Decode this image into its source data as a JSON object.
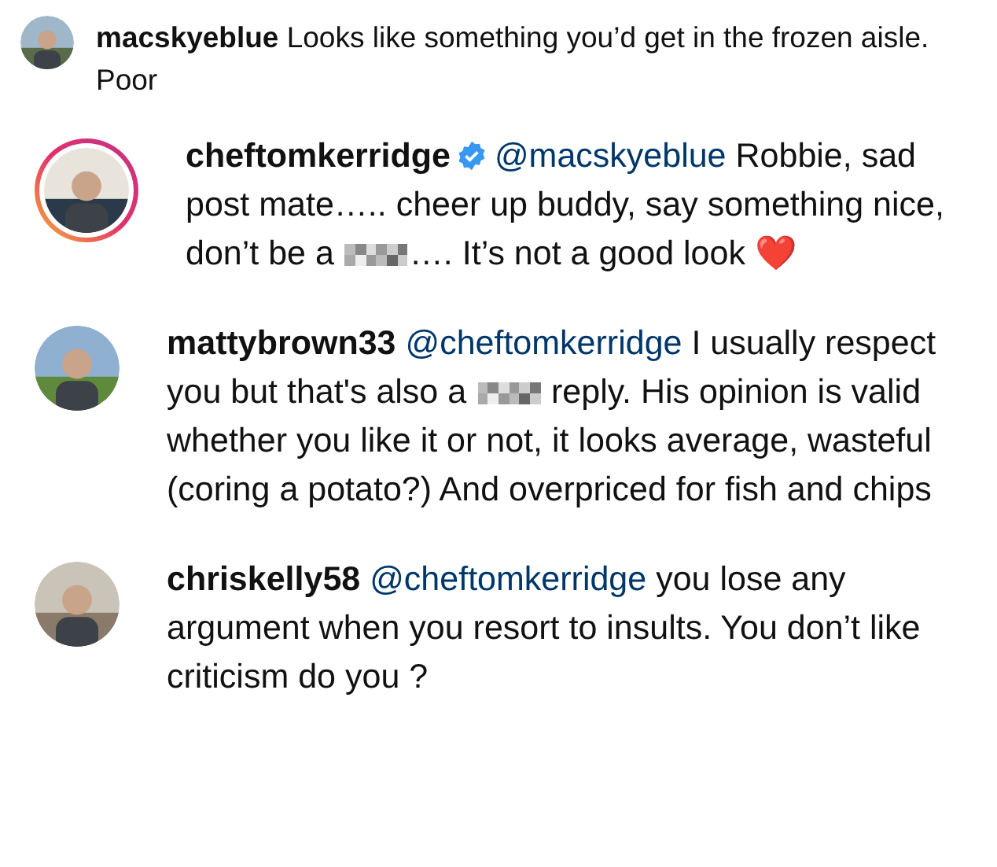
{
  "comments": [
    {
      "kind": "top",
      "username": "macskyeblue",
      "ring": false,
      "verified": false,
      "segments": [
        {
          "kind": "text",
          "text": "Looks like something you’d get in the frozen aisle. Poor"
        }
      ]
    },
    {
      "kind": "reply",
      "username": "cheftomkerridge",
      "ring": true,
      "verified": true,
      "segments": [
        {
          "kind": "mention",
          "text": "@macskyeblue"
        },
        {
          "kind": "text",
          "text": " Robbie, sad post mate….. cheer up buddy, say something nice, don’t be a "
        },
        {
          "kind": "censored"
        },
        {
          "kind": "text",
          "text": "…. It’s not a good look ❤️"
        }
      ]
    },
    {
      "kind": "reply",
      "username": "mattybrown33",
      "ring": false,
      "verified": false,
      "segments": [
        {
          "kind": "mention",
          "text": "@cheftomkerridge"
        },
        {
          "kind": "text",
          "text": " I usually respect you but that's also a "
        },
        {
          "kind": "censored"
        },
        {
          "kind": "text",
          "text": " reply. His opinion is valid whether you like it or not, it looks average, wasteful (coring a potato?) And overpriced for fish and chips"
        }
      ]
    },
    {
      "kind": "reply",
      "username": "chriskelly58",
      "ring": false,
      "verified": false,
      "segments": [
        {
          "kind": "mention",
          "text": "@cheftomkerridge"
        },
        {
          "kind": "text",
          "text": " you lose any argument when you resort to insults. You don’t like criticism do you ?"
        }
      ]
    }
  ]
}
